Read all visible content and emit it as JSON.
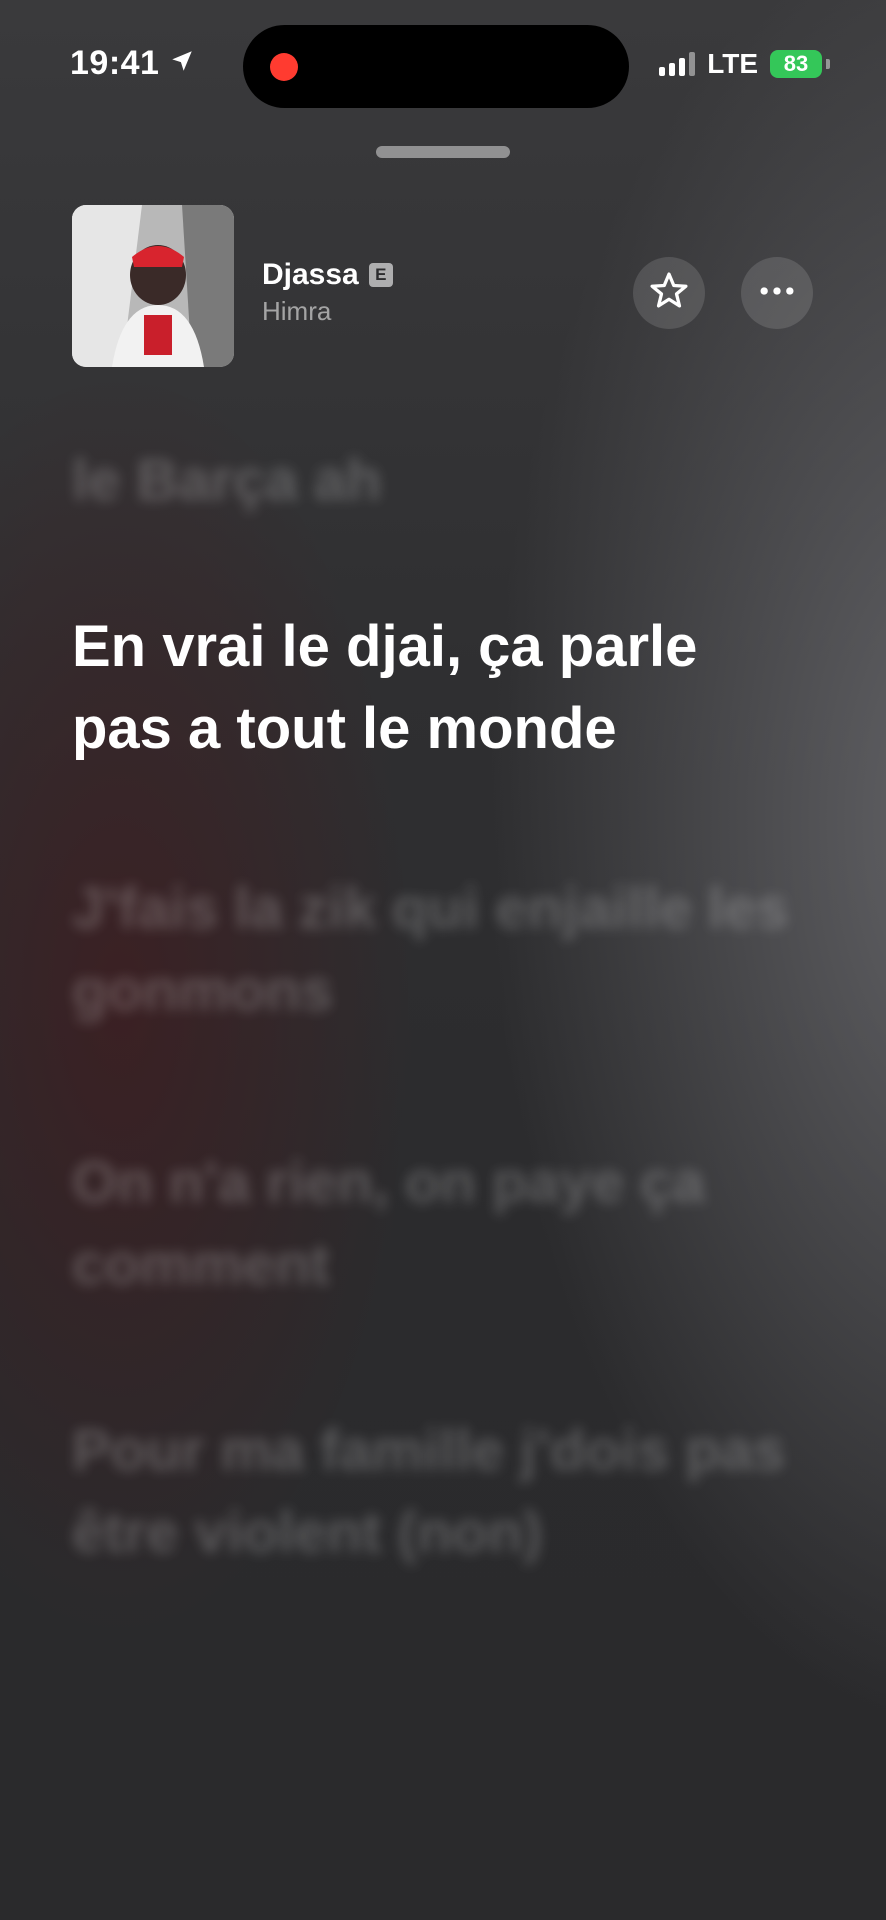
{
  "status_bar": {
    "time": "19:41",
    "network": "LTE",
    "battery": "83"
  },
  "now_playing": {
    "title": "Djassa",
    "explicit_badge": "E",
    "artist": "Himra"
  },
  "lyrics": {
    "previous": "le Barça ah",
    "current": "En vrai le djai, ça parle pas a tout le monde",
    "upcoming": [
      "J'fais la zik qui enjaille les gonmons",
      "On n'a rien, on paye ça comment",
      "Pour ma famille j'dois pas être violent (non)"
    ]
  },
  "colors": {
    "accent_record": "#ff3b30",
    "battery": "#34c759"
  },
  "icons": [
    "location-arrow-icon",
    "signal-icon",
    "battery-icon",
    "star-icon",
    "more-icon"
  ]
}
